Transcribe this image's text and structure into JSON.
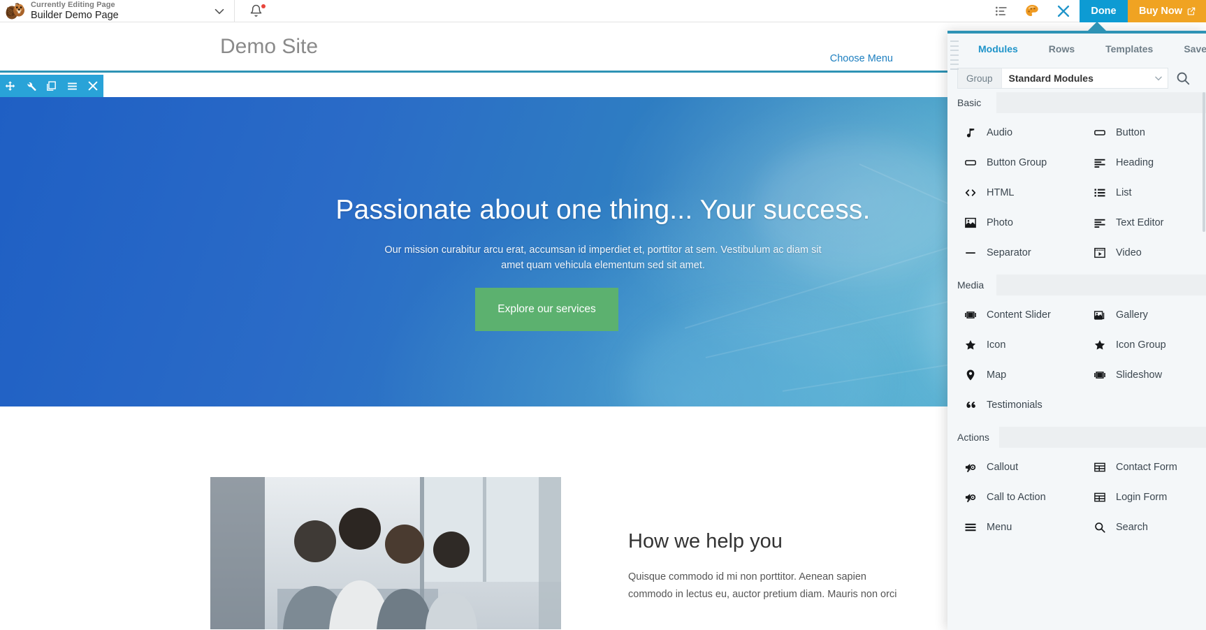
{
  "admin_bar": {
    "logo_icon": "beaver-logo",
    "editing_kicker": "Currently Editing Page",
    "editing_title": "Builder Demo Page",
    "dropdown_icon": "chevron-down-icon",
    "notifications_icon": "bell-icon",
    "tools_icon": "list-settings-icon",
    "theme_icon": "beaver-palette-icon",
    "close_icon": "close-icon",
    "done_label": "Done",
    "buy_now_label": "Buy Now",
    "buy_now_external_icon": "external-link-icon",
    "accent_blue": "#0d9bd3",
    "accent_orange": "#f0a322"
  },
  "site": {
    "title": "Demo Site",
    "choose_menu_label": "Choose Menu",
    "header_border_color": "#2e93b5"
  },
  "row_toolbar": {
    "background": "#29a3d8",
    "tools": [
      {
        "name": "move-handle",
        "icon": "move-arrows-icon"
      },
      {
        "name": "row-settings",
        "icon": "wrench-icon"
      },
      {
        "name": "duplicate-row",
        "icon": "copy-icon"
      },
      {
        "name": "row-menu",
        "icon": "hamburger-icon"
      },
      {
        "name": "remove-row",
        "icon": "close-icon"
      }
    ]
  },
  "hero": {
    "heading": "Passionate about one thing... Your success.",
    "subtext": "Our mission curabitur arcu erat, accumsan id imperdiet et, porttitor at sem. Vestibulum ac diam sit amet quam vehicula elementum sed sit amet.",
    "button_label": "Explore our services",
    "button_color": "#5cb16f"
  },
  "section_two": {
    "photo_alt": "team-photo",
    "heading": "How we help you",
    "body": "Quisque commodo id mi non porttitor. Aenean sapien commodo in lectus eu, auctor pretium diam. Mauris non orci"
  },
  "panel": {
    "tabs": [
      {
        "label": "Modules",
        "active": true
      },
      {
        "label": "Rows",
        "active": false
      },
      {
        "label": "Templates",
        "active": false
      },
      {
        "label": "Saved",
        "active": false
      }
    ],
    "group_label": "Group",
    "group_value": "Standard Modules",
    "search_icon": "search-icon",
    "sections": [
      {
        "title": "Basic",
        "modules": [
          {
            "label": "Audio",
            "icon": "audio-note-icon"
          },
          {
            "label": "Button",
            "icon": "button-rect-icon"
          },
          {
            "label": "Button Group",
            "icon": "button-rect-icon"
          },
          {
            "label": "Heading",
            "icon": "heading-lines-icon"
          },
          {
            "label": "HTML",
            "icon": "code-brackets-icon"
          },
          {
            "label": "List",
            "icon": "list-bullets-icon"
          },
          {
            "label": "Photo",
            "icon": "photo-image-icon"
          },
          {
            "label": "Text Editor",
            "icon": "heading-lines-icon"
          },
          {
            "label": "Separator",
            "icon": "separator-dash-icon"
          },
          {
            "label": "Video",
            "icon": "video-play-icon"
          }
        ]
      },
      {
        "title": "Media",
        "modules": [
          {
            "label": "Content Slider",
            "icon": "slider-icon"
          },
          {
            "label": "Gallery",
            "icon": "gallery-images-icon"
          },
          {
            "label": "Icon",
            "icon": "star-icon"
          },
          {
            "label": "Icon Group",
            "icon": "star-icon"
          },
          {
            "label": "Map",
            "icon": "map-pin-icon"
          },
          {
            "label": "Slideshow",
            "icon": "slider-icon"
          },
          {
            "label": "Testimonials",
            "icon": "quote-icon"
          }
        ]
      },
      {
        "title": "Actions",
        "modules": [
          {
            "label": "Callout",
            "icon": "megaphone-icon"
          },
          {
            "label": "Contact Form",
            "icon": "table-form-icon"
          },
          {
            "label": "Call to Action",
            "icon": "megaphone-icon"
          },
          {
            "label": "Login Form",
            "icon": "table-form-icon"
          },
          {
            "label": "Menu",
            "icon": "hamburger-icon"
          },
          {
            "label": "Search",
            "icon": "search-icon"
          }
        ]
      }
    ]
  }
}
